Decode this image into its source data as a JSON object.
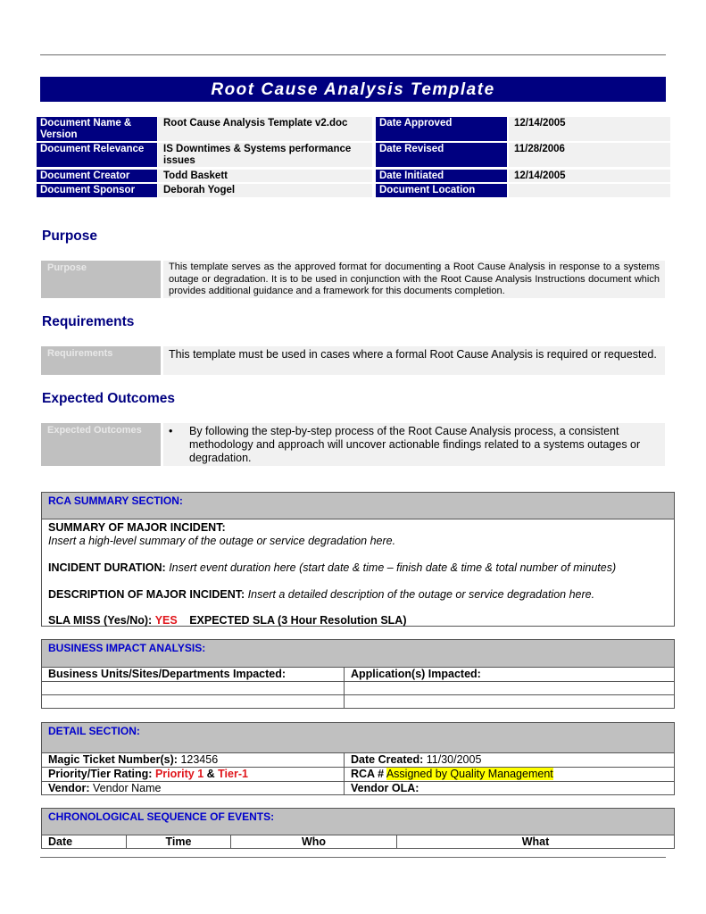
{
  "title": "Root Cause Analysis Template",
  "doc_info": {
    "left": [
      {
        "label": "Document Name & Version",
        "value": "Root Cause Analysis Template v2.doc"
      },
      {
        "label": "Document Relevance",
        "value": "IS Downtimes & Systems performance issues"
      },
      {
        "label": "Document Creator",
        "value": "Todd Baskett"
      },
      {
        "label": "Document Sponsor",
        "value": "Deborah Yogel"
      }
    ],
    "right": [
      {
        "label": "Date Approved",
        "value": "12/14/2005"
      },
      {
        "label": "Date Revised",
        "value": "11/28/2006"
      },
      {
        "label": "Date Initiated",
        "value": "12/14/2005"
      },
      {
        "label": "Document Location",
        "value": ""
      }
    ]
  },
  "purpose": {
    "heading": "Purpose",
    "label": "Purpose",
    "text": "This template serves as the approved format for documenting a Root Cause Analysis in response to a systems outage or degradation. It is to be used in conjunction with the Root Cause Analysis Instructions document which provides additional guidance and a framework for this documents completion."
  },
  "requirements": {
    "heading": "Requirements",
    "label": "Requirements",
    "text": "This template must be used in cases where a formal Root Cause Analysis is required or requested."
  },
  "expected_outcomes": {
    "heading": "Expected Outcomes",
    "label": "Expected Outcomes",
    "bullet": "•",
    "text": "By following the step-by-step process of the Root Cause Analysis process, a consistent methodology and approach will uncover actionable findings related to a systems outages or degradation."
  },
  "rca_summary": {
    "header": "RCA SUMMARY SECTION:",
    "summary_label": "SUMMARY OF MAJOR INCIDENT:",
    "summary_text": "Insert a high-level summary of the outage or service degradation here.",
    "duration_label": "INCIDENT DURATION:",
    "duration_text": "Insert event duration here (start date &  time – finish date & time & total number of minutes)",
    "description_label": "DESCRIPTION OF MAJOR INCIDENT:",
    "description_text": "Insert a detailed description of the outage or service degradation here.",
    "sla_miss_label": "SLA MISS (Yes/No):",
    "sla_miss_value": "YES",
    "expected_sla": "EXPECTED SLA (3 Hour Resolution SLA)"
  },
  "business_impact": {
    "header": "BUSINESS IMPACT ANALYSIS:",
    "col1": "Business Units/Sites/Departments Impacted:",
    "col2": "Application(s) Impacted:"
  },
  "detail": {
    "header": "DETAIL SECTION:",
    "ticket_label": "Magic Ticket Number(s):",
    "ticket_value": "123456",
    "date_created_label": "Date Created:",
    "date_created_value": "11/30/2005",
    "priority_label": "Priority/Tier Rating:",
    "priority_value": "Priority 1",
    "priority_sep": "&",
    "tier_value": "Tier-1",
    "rca_label": "RCA #",
    "rca_value": "Assigned by Quality Management",
    "vendor_label": "Vendor:",
    "vendor_value": "Vendor Name",
    "vendor_ola_label": "Vendor OLA:"
  },
  "chronology": {
    "header": "CHRONOLOGICAL SEQUENCE OF EVENTS:",
    "columns": [
      "Date",
      "Time",
      "Who",
      "What"
    ]
  },
  "colors": {
    "navy": "#000080",
    "section_blue": "#0000cc",
    "alert_red": "#e0151b",
    "highlight_yellow": "#ffff00",
    "grey_header": "#c0c0c0"
  }
}
